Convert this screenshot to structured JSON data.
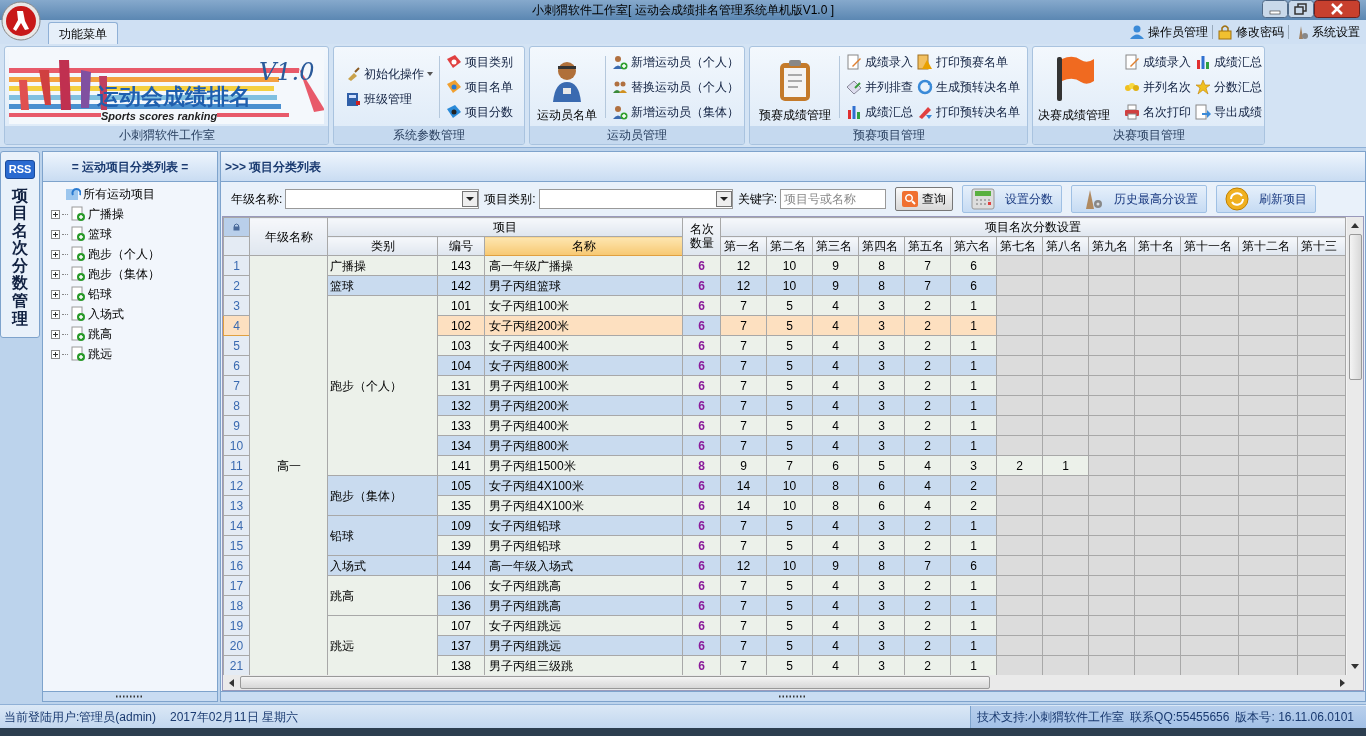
{
  "window": {
    "title": "小刺猬软件工作室[ 运动会成绩排名管理系统单机版V1.0 ]"
  },
  "ribbon": {
    "tabs": [
      {
        "label": "功能菜单",
        "selected": true
      }
    ],
    "quick_links": [
      {
        "label": "操作员管理"
      },
      {
        "label": "修改密码"
      },
      {
        "label": "系统设置"
      }
    ],
    "groups": [
      {
        "title": "小刺猬软件工作室",
        "kind": "banner",
        "banner": {
          "title": "运动会成绩排名",
          "subtitle": "Sports scores ranking",
          "version": "V1.0"
        }
      },
      {
        "title": "系统参数管理",
        "kind": "buttons",
        "columns": [
          [
            {
              "label": "初始化操作",
              "dropdown": true
            },
            {
              "label": "班级管理"
            }
          ],
          [
            {
              "label": "项目类别"
            },
            {
              "label": "项目名单"
            },
            {
              "label": "项目分数"
            }
          ]
        ]
      },
      {
        "title": "运动员管理",
        "kind": "buttons",
        "large": {
          "label": "运动员名单"
        },
        "columns": [
          [
            {
              "label": "新增运动员（个人）"
            },
            {
              "label": "替换运动员（个人）"
            },
            {
              "label": "新增运动员（集体）"
            }
          ]
        ]
      },
      {
        "title": "预赛项目管理",
        "kind": "buttons",
        "large": {
          "label": "预赛成绩管理"
        },
        "columns": [
          [
            {
              "label": "成绩录入"
            },
            {
              "label": "并列排查"
            },
            {
              "label": "成绩汇总"
            }
          ],
          [
            {
              "label": "打印预赛名单"
            },
            {
              "label": "生成预转决名单"
            },
            {
              "label": "打印预转决名单"
            }
          ]
        ]
      },
      {
        "title": "决赛项目管理",
        "kind": "buttons",
        "large": {
          "label": "决赛成绩管理"
        },
        "columns": [
          [
            {
              "label": "成绩录入"
            },
            {
              "label": "并列名次"
            },
            {
              "label": "名次打印"
            }
          ],
          [
            {
              "label": "成绩汇总"
            },
            {
              "label": "分数汇总"
            },
            {
              "label": "导出成绩"
            }
          ]
        ]
      }
    ]
  },
  "side_tabs": [
    {
      "badge": "RSS",
      "label": "项目名次分数管理",
      "selected": true
    }
  ],
  "tree": {
    "title": "= 运动项目分类列表 =",
    "root": {
      "label": "所有运动项目",
      "children": [
        {
          "label": "广播操",
          "expanded": false
        },
        {
          "label": "篮球",
          "expanded": false
        },
        {
          "label": "跑步（个人）",
          "expanded": false
        },
        {
          "label": "跑步（集体）",
          "expanded": false
        },
        {
          "label": "铅球",
          "expanded": false
        },
        {
          "label": "入场式",
          "expanded": false
        },
        {
          "label": "跳高",
          "expanded": false
        },
        {
          "label": "跳远",
          "expanded": false
        }
      ]
    }
  },
  "main": {
    "title": ">>> 项目分类列表",
    "filters": [
      {
        "kind": "select",
        "label": "年级名称:"
      },
      {
        "kind": "select",
        "label": "项目类别:"
      },
      {
        "kind": "input",
        "label": "关键字:",
        "placeholder": "项目号或名称"
      }
    ],
    "buttons": [
      {
        "label": "查询"
      },
      {
        "label": "设置分数"
      },
      {
        "label": "历史最高分设置"
      },
      {
        "label": "刷新项目"
      }
    ]
  },
  "table": {
    "grade_header": "年级名称",
    "item_header": "项目",
    "item_columns": [
      {
        "label": "类别",
        "selected": false
      },
      {
        "label": "编号",
        "selected": false
      },
      {
        "label": "名称",
        "selected": true
      }
    ],
    "count_header": "名次数量",
    "rank_header": "项目名次分数设置",
    "rank_columns": [
      "第一名",
      "第二名",
      "第三名",
      "第四名",
      "第五名",
      "第六名",
      "第七名",
      "第八名",
      "第九名",
      "第十名",
      "第十一名",
      "第十二名",
      "第十三"
    ],
    "grades": [
      {
        "name": "高一",
        "categories": [
          {
            "name": "广播操",
            "rows": [
              {
                "index": "1",
                "code": "143",
                "name": "高一年级广播操",
                "count": "6",
                "scores": [
                  "12",
                  "10",
                  "9",
                  "8",
                  "7",
                  "6"
                ],
                "selected": false
              }
            ]
          },
          {
            "name": "篮球",
            "rows": [
              {
                "index": "2",
                "code": "142",
                "name": "男子丙组篮球",
                "count": "6",
                "scores": [
                  "12",
                  "10",
                  "9",
                  "8",
                  "7",
                  "6"
                ],
                "selected": false
              }
            ]
          },
          {
            "name": "跑步（个人）",
            "rows": [
              {
                "index": "3",
                "code": "101",
                "name": "女子丙组100米",
                "count": "6",
                "scores": [
                  "7",
                  "5",
                  "4",
                  "3",
                  "2",
                  "1"
                ],
                "selected": false
              },
              {
                "index": "4",
                "code": "102",
                "name": "女子丙组200米",
                "count": "6",
                "scores": [
                  "7",
                  "5",
                  "4",
                  "3",
                  "2",
                  "1"
                ],
                "selected": true
              },
              {
                "index": "5",
                "code": "103",
                "name": "女子丙组400米",
                "count": "6",
                "scores": [
                  "7",
                  "5",
                  "4",
                  "3",
                  "2",
                  "1"
                ],
                "selected": false
              },
              {
                "index": "6",
                "code": "104",
                "name": "女子丙组800米",
                "count": "6",
                "scores": [
                  "7",
                  "5",
                  "4",
                  "3",
                  "2",
                  "1"
                ],
                "selected": false
              },
              {
                "index": "7",
                "code": "131",
                "name": "男子丙组100米",
                "count": "6",
                "scores": [
                  "7",
                  "5",
                  "4",
                  "3",
                  "2",
                  "1"
                ],
                "selected": false
              },
              {
                "index": "8",
                "code": "132",
                "name": "男子丙组200米",
                "count": "6",
                "scores": [
                  "7",
                  "5",
                  "4",
                  "3",
                  "2",
                  "1"
                ],
                "selected": false
              },
              {
                "index": "9",
                "code": "133",
                "name": "男子丙组400米",
                "count": "6",
                "scores": [
                  "7",
                  "5",
                  "4",
                  "3",
                  "2",
                  "1"
                ],
                "selected": false
              },
              {
                "index": "10",
                "code": "134",
                "name": "男子丙组800米",
                "count": "6",
                "scores": [
                  "7",
                  "5",
                  "4",
                  "3",
                  "2",
                  "1"
                ],
                "selected": false
              },
              {
                "index": "11",
                "code": "141",
                "name": "男子丙组1500米",
                "count": "8",
                "scores": [
                  "9",
                  "7",
                  "6",
                  "5",
                  "4",
                  "3",
                  "2",
                  "1"
                ],
                "selected": false
              }
            ]
          },
          {
            "name": "跑步（集体）",
            "rows": [
              {
                "index": "12",
                "code": "105",
                "name": "女子丙组4X100米",
                "count": "6",
                "scores": [
                  "14",
                  "10",
                  "8",
                  "6",
                  "4",
                  "2"
                ],
                "selected": false
              },
              {
                "index": "13",
                "code": "135",
                "name": "男子丙组4X100米",
                "count": "6",
                "scores": [
                  "14",
                  "10",
                  "8",
                  "6",
                  "4",
                  "2"
                ],
                "selected": false
              }
            ]
          },
          {
            "name": "铅球",
            "rows": [
              {
                "index": "14",
                "code": "109",
                "name": "女子丙组铅球",
                "count": "6",
                "scores": [
                  "7",
                  "5",
                  "4",
                  "3",
                  "2",
                  "1"
                ],
                "selected": false
              },
              {
                "index": "15",
                "code": "139",
                "name": "男子丙组铅球",
                "count": "6",
                "scores": [
                  "7",
                  "5",
                  "4",
                  "3",
                  "2",
                  "1"
                ],
                "selected": false
              }
            ]
          },
          {
            "name": "入场式",
            "rows": [
              {
                "index": "16",
                "code": "144",
                "name": "高一年级入场式",
                "count": "6",
                "scores": [
                  "12",
                  "10",
                  "9",
                  "8",
                  "7",
                  "6"
                ],
                "selected": false
              }
            ]
          },
          {
            "name": "跳高",
            "rows": [
              {
                "index": "17",
                "code": "106",
                "name": "女子丙组跳高",
                "count": "6",
                "scores": [
                  "7",
                  "5",
                  "4",
                  "3",
                  "2",
                  "1"
                ],
                "selected": false
              },
              {
                "index": "18",
                "code": "136",
                "name": "男子丙组跳高",
                "count": "6",
                "scores": [
                  "7",
                  "5",
                  "4",
                  "3",
                  "2",
                  "1"
                ],
                "selected": false
              }
            ]
          },
          {
            "name": "跳远",
            "rows": [
              {
                "index": "19",
                "code": "107",
                "name": "女子丙组跳远",
                "count": "6",
                "scores": [
                  "7",
                  "5",
                  "4",
                  "3",
                  "2",
                  "1"
                ],
                "selected": false
              },
              {
                "index": "20",
                "code": "137",
                "name": "男子丙组跳远",
                "count": "6",
                "scores": [
                  "7",
                  "5",
                  "4",
                  "3",
                  "2",
                  "1"
                ],
                "selected": false
              },
              {
                "index": "21",
                "code": "138",
                "name": "男子丙组三级跳",
                "count": "6",
                "scores": [
                  "7",
                  "5",
                  "4",
                  "3",
                  "2",
                  "1"
                ],
                "selected": false
              }
            ]
          }
        ]
      }
    ]
  },
  "status_bar": {
    "left": [
      "当前登陆用户:管理员(admin)",
      "2017年02月11日 星期六"
    ],
    "right": [
      "技术支持:小刺猬软件工作室",
      "联系QQ:55455656",
      "版本号: 16.11.06.0101"
    ]
  }
}
